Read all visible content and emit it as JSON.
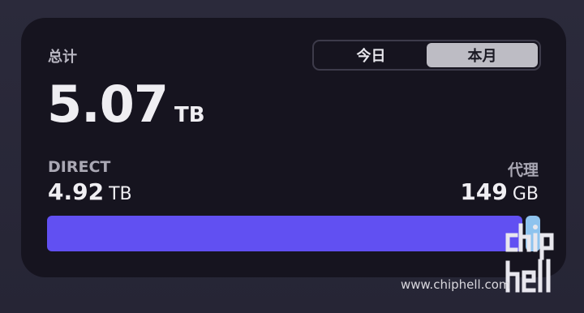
{
  "summary": {
    "total_label": "总计",
    "total_value": "5.07",
    "total_unit": "TB"
  },
  "period_toggle": {
    "options": [
      "今日",
      "本月"
    ],
    "selected": "本月"
  },
  "direct": {
    "label": "DIRECT",
    "value": "4.92",
    "unit": "TB"
  },
  "proxy": {
    "label": "代理",
    "value": "149",
    "unit": "GB"
  },
  "usage_bar": {
    "direct_fraction": 0.971,
    "proxy_fraction": 0.029,
    "direct_color": "#6150f2",
    "proxy_color": "#8ec3ee"
  },
  "watermark": {
    "text": "www.chiphell.com",
    "logo_text": "chip hell"
  }
}
